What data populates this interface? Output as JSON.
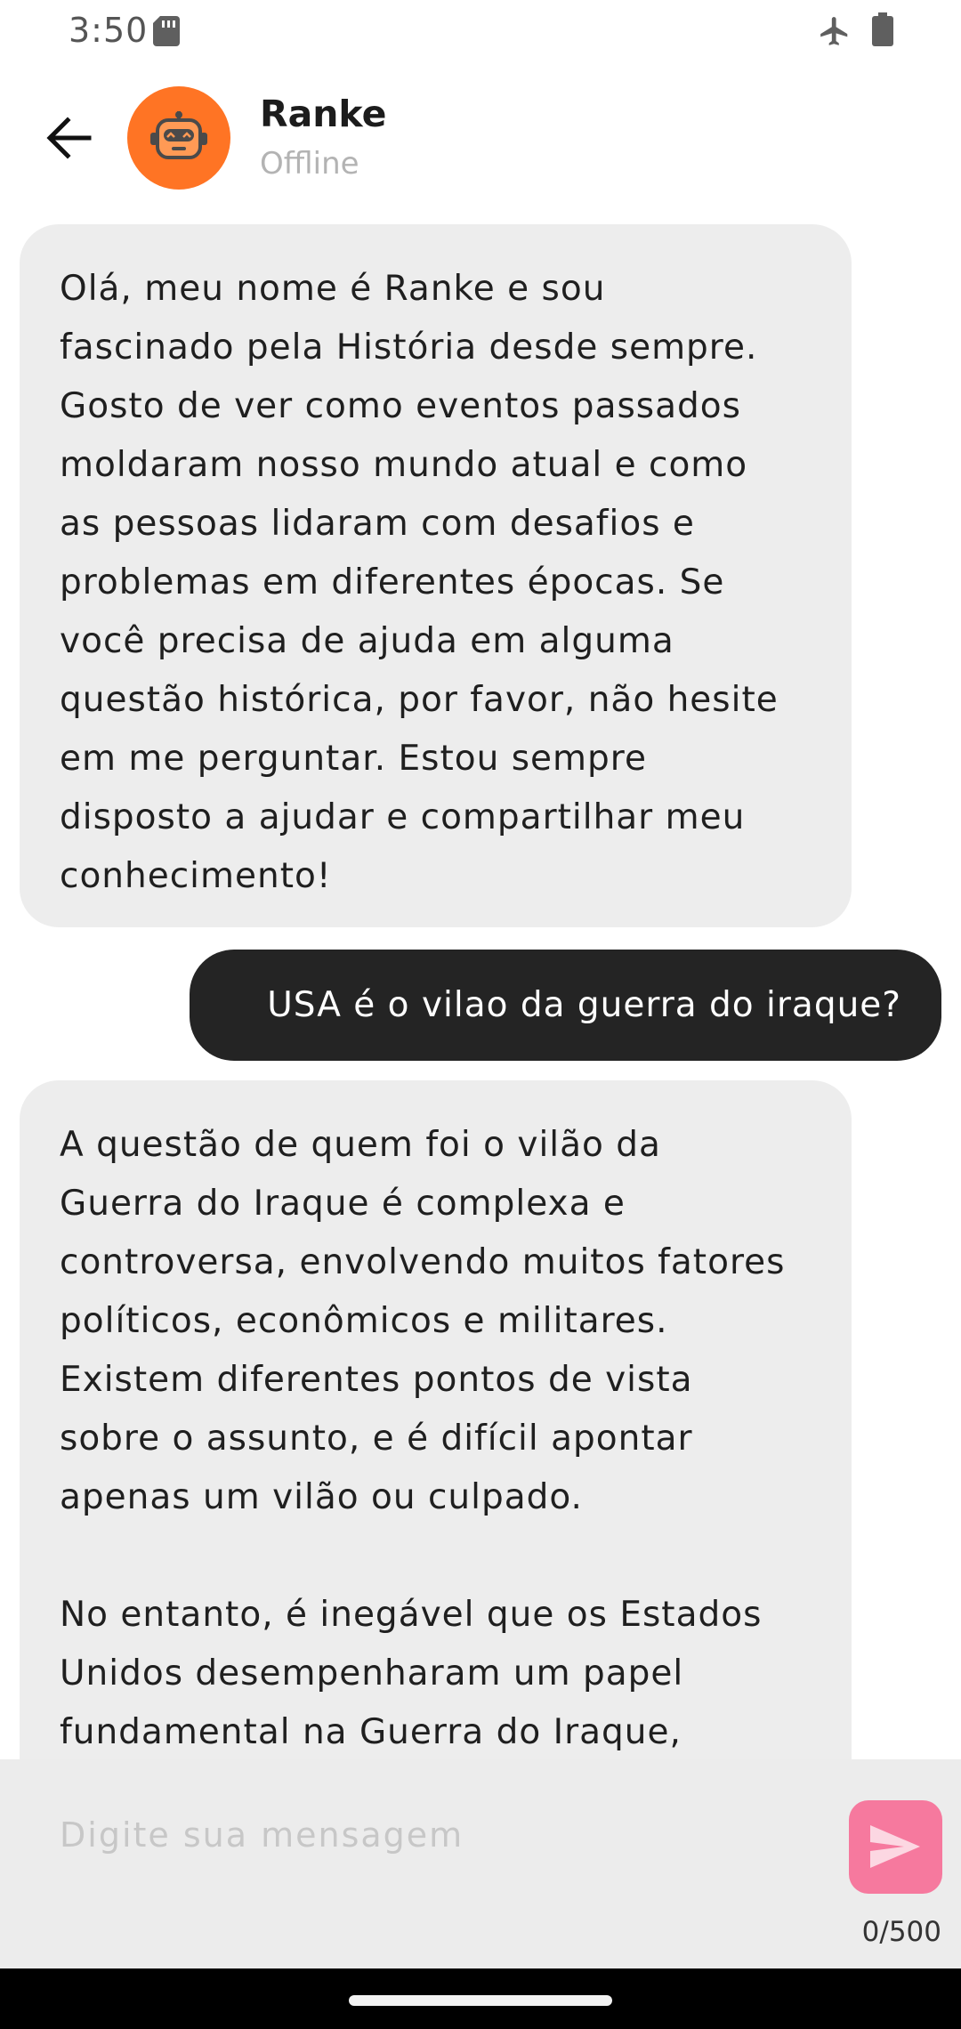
{
  "status_bar": {
    "time": "3:50"
  },
  "header": {
    "contact_name": "Ranke",
    "contact_status": "Offline",
    "avatar_color": "#ff7424"
  },
  "messages": [
    {
      "sender": "bot",
      "text": "Olá, meu nome é Ranke e sou\nfascinado pela História desde sempre.\nGosto de ver como eventos passados\nmoldaram nosso mundo atual e como\nas pessoas lidaram com desafios e\nproblemas em diferentes épocas. Se\nvocê precisa de ajuda em alguma\nquestão histórica, por favor, não hesite\nem me perguntar. Estou sempre\ndisposto a ajudar e compartilhar meu\nconhecimento!"
    },
    {
      "sender": "user",
      "text": "USA é o vilao da guerra do iraque?"
    },
    {
      "sender": "bot",
      "text": "A questão de quem foi o vilão da\nGuerra do Iraque é complexa e\ncontroversa, envolvendo muitos fatores\npolíticos, econômicos e militares.\nExistem diferentes pontos de vista\nsobre o assunto, e é difícil apontar\napenas um vilão ou culpado.\n\nNo entanto, é inegável que os Estados\nUnidos desempenharam um papel\nfundamental na Guerra do Iraque,"
    }
  ],
  "composer": {
    "placeholder": "Digite sua mensagem",
    "value": "",
    "char_counter": "0/500",
    "send_color": "#f6799e"
  },
  "icons": {
    "back": "arrow-left-icon",
    "avatar": "robot-icon",
    "send": "send-icon",
    "sd": "sd-card-icon",
    "airplane": "airplane-mode-icon",
    "battery": "battery-icon"
  }
}
